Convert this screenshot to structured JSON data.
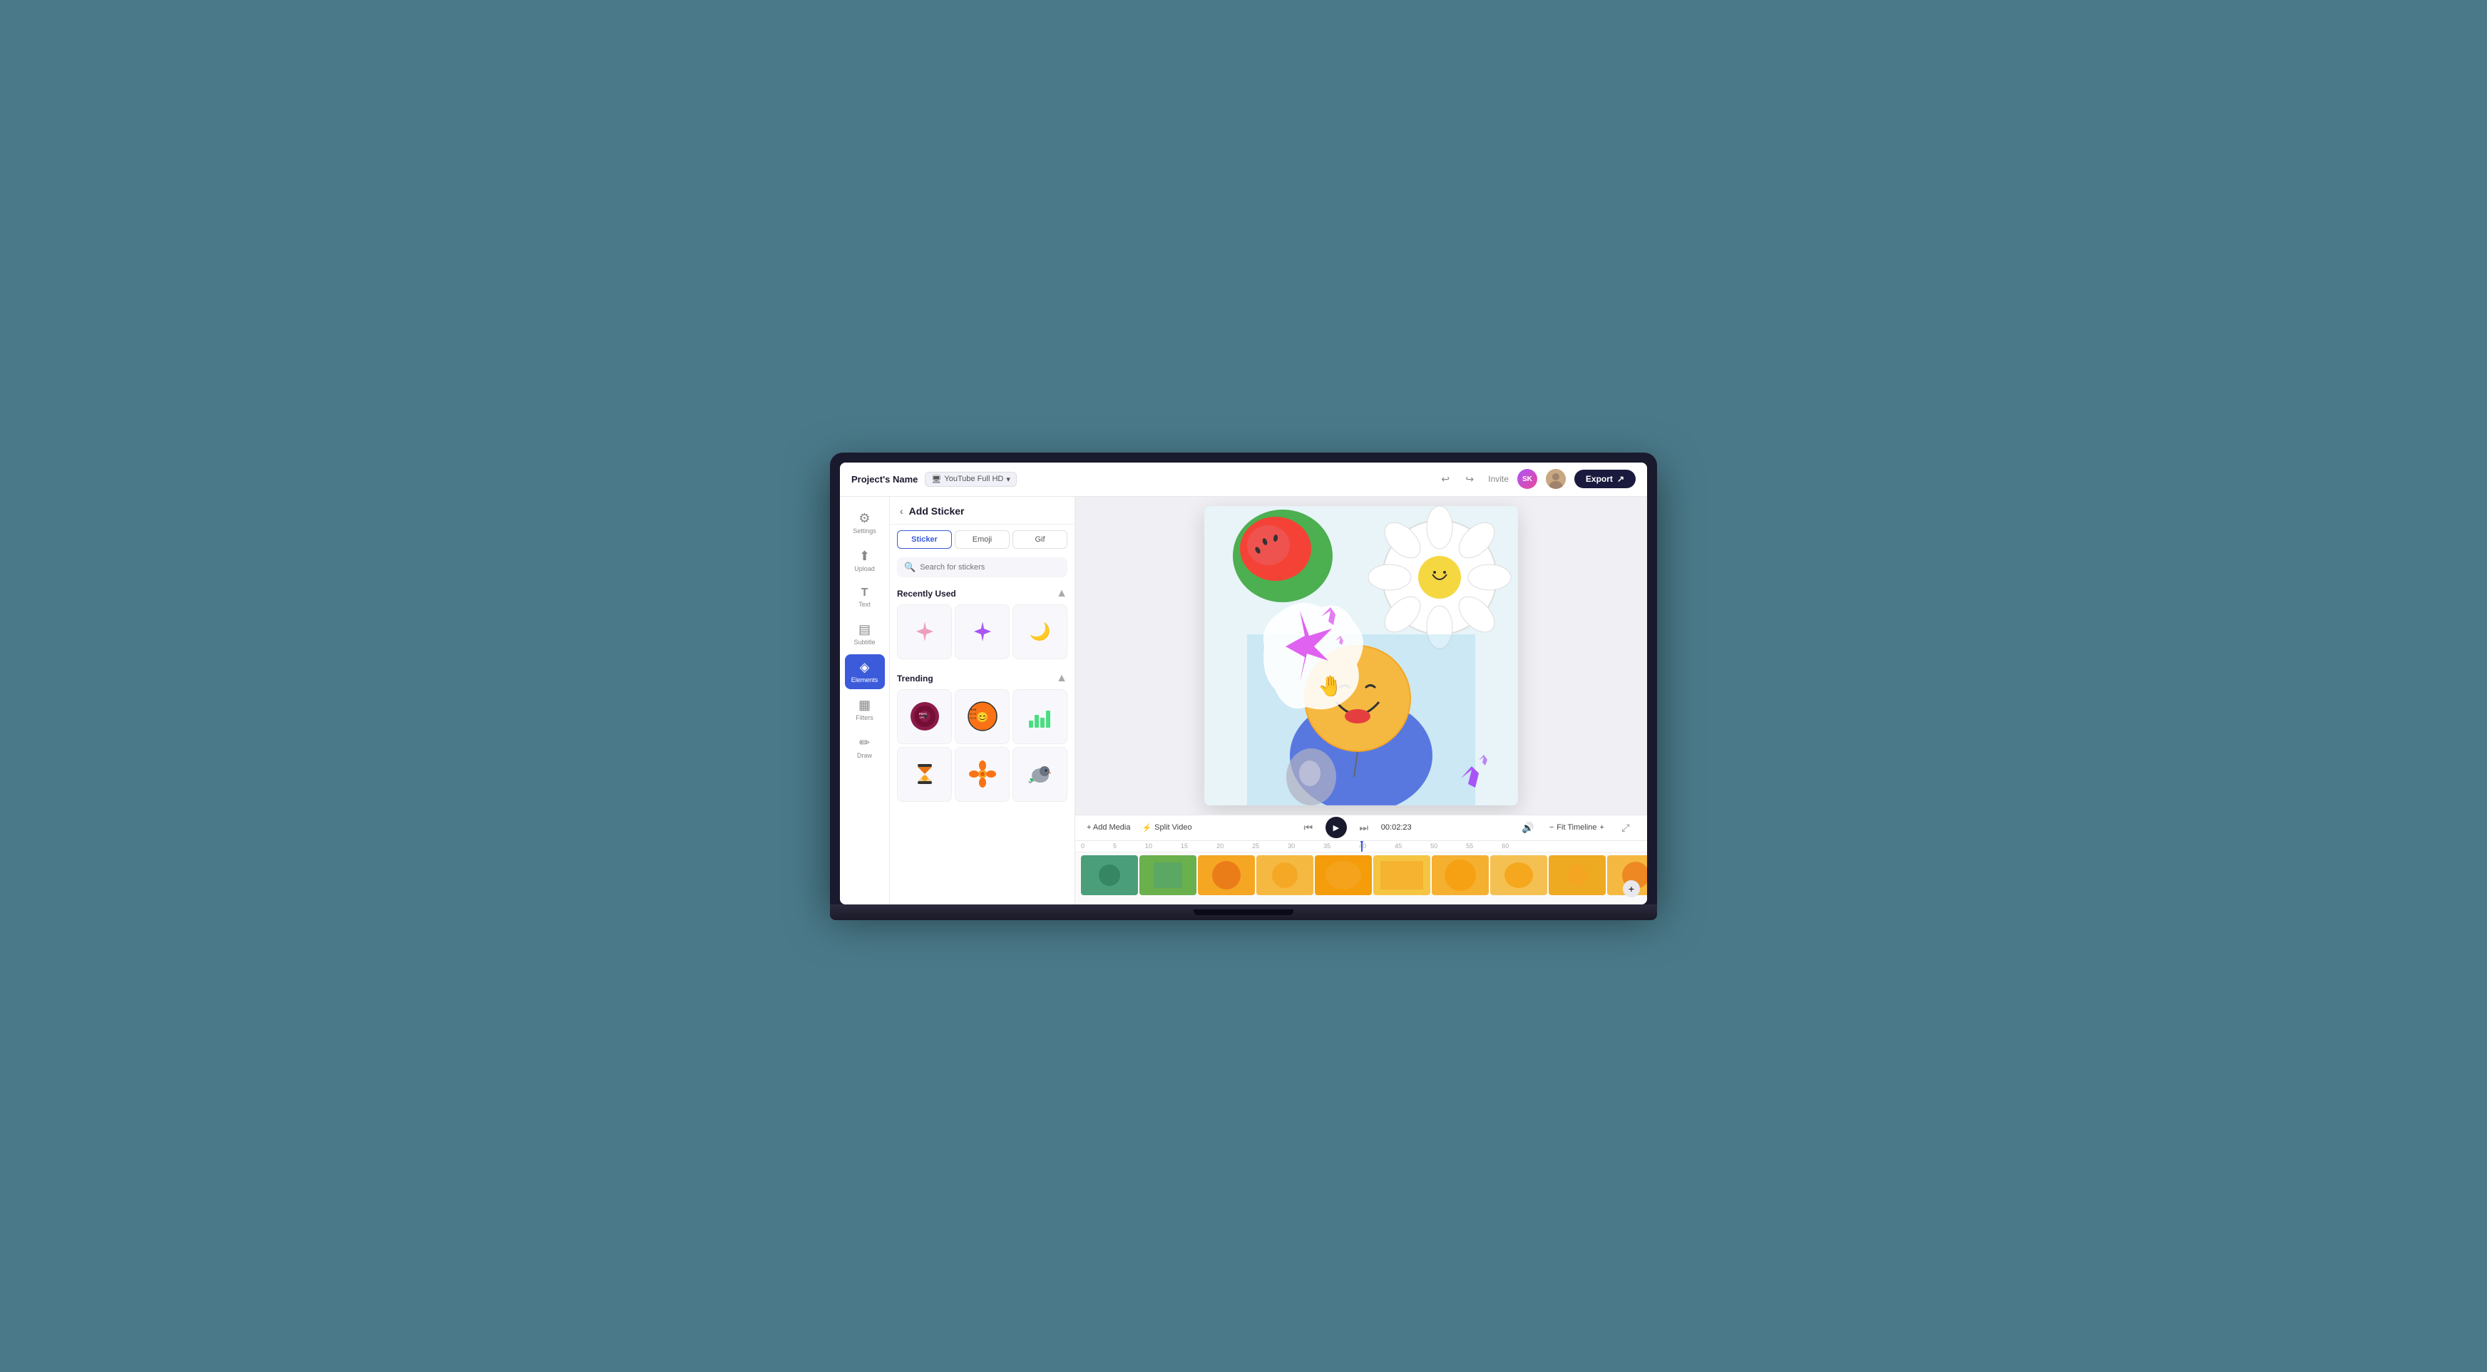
{
  "topbar": {
    "project_name": "Project's Name",
    "resolution": "YouTube Full HD",
    "undo_label": "↩",
    "redo_label": "↪",
    "invite_label": "Invite",
    "sk_initials": "SK",
    "export_label": "Export"
  },
  "sidebar": {
    "items": [
      {
        "id": "settings",
        "icon": "⚙",
        "label": "Settings"
      },
      {
        "id": "upload",
        "icon": "↑",
        "label": "Upload"
      },
      {
        "id": "text",
        "icon": "T",
        "label": "Text"
      },
      {
        "id": "subtitle",
        "icon": "≡",
        "label": "Subtitle"
      },
      {
        "id": "elements",
        "icon": "◈",
        "label": "Elements",
        "active": true
      },
      {
        "id": "filters",
        "icon": "▦",
        "label": "Filters"
      },
      {
        "id": "draw",
        "icon": "✏",
        "label": "Draw"
      }
    ]
  },
  "panel": {
    "title": "Add Sticker",
    "tabs": [
      {
        "id": "sticker",
        "label": "Sticker",
        "active": true
      },
      {
        "id": "emoji",
        "label": "Emoji",
        "active": false
      },
      {
        "id": "gif",
        "label": "Gif",
        "active": false
      }
    ],
    "search": {
      "placeholder": "Search for stickers"
    },
    "recently_used": {
      "title": "Recently Used",
      "stickers": [
        "✦",
        "✦",
        "🌙"
      ]
    },
    "trending": {
      "title": "Trending",
      "stickers": [
        "🎵",
        "😊",
        "📊",
        "⏳",
        "🌸",
        "🐦"
      ]
    }
  },
  "playback": {
    "skip_back": "⏮",
    "play": "▶",
    "skip_forward": "⏭",
    "time": "00:02:23",
    "volume_icon": "🔊",
    "fit_timeline": "Fit Timeline"
  },
  "bottom_toolbar": {
    "add_media": "+ Add Media",
    "split_video": "Split Video"
  },
  "timeline": {
    "markers": [
      "0",
      "5",
      "10",
      "15",
      "20",
      "25",
      "30",
      "35",
      "40",
      "45",
      "50",
      "55",
      "60"
    ]
  }
}
